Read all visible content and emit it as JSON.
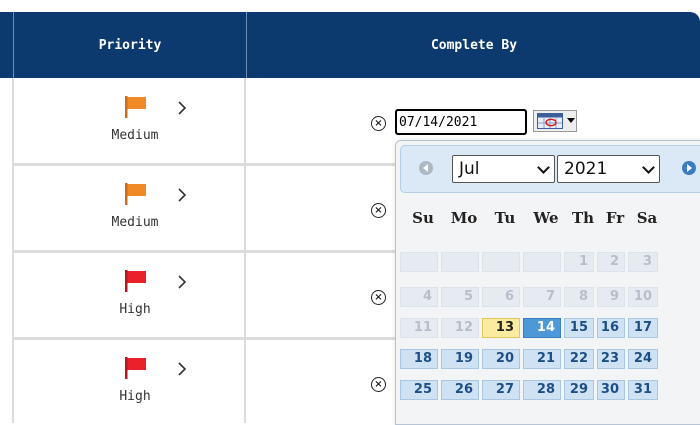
{
  "header": {
    "priority_label": "Priority",
    "complete_by_label": "Complete By"
  },
  "rows": [
    {
      "priority": "Medium",
      "flag_color": "#ef8a27"
    },
    {
      "priority": "Medium",
      "flag_color": "#ef8a27"
    },
    {
      "priority": "High",
      "flag_color": "#e8212a"
    },
    {
      "priority": "High",
      "flag_color": "#e8212a"
    }
  ],
  "date_input": {
    "value": "07/14/2021"
  },
  "calendar": {
    "month": "Jul",
    "year": "2021",
    "weekdays": [
      "Su",
      "Mo",
      "Tu",
      "We",
      "Th",
      "Fr",
      "Sa"
    ],
    "weeks": [
      [
        "",
        "",
        "",
        "",
        "1",
        "2",
        "3"
      ],
      [
        "4",
        "5",
        "6",
        "7",
        "8",
        "9",
        "10"
      ],
      [
        "11",
        "12",
        "13",
        "14",
        "15",
        "16",
        "17"
      ],
      [
        "18",
        "19",
        "20",
        "21",
        "22",
        "23",
        "24"
      ],
      [
        "25",
        "26",
        "27",
        "28",
        "29",
        "30",
        "31"
      ]
    ],
    "today": "13",
    "selected": "14",
    "disabled_before": 13
  },
  "colors": {
    "header_bg": "#0d3a6e",
    "today_bg": "#fbeb9f",
    "selected_bg": "#4d99d8"
  },
  "icons": {
    "flag": "flag-icon",
    "chevron": "chevron-right-icon",
    "clear": "clear-icon",
    "calendar": "calendar-icon"
  }
}
